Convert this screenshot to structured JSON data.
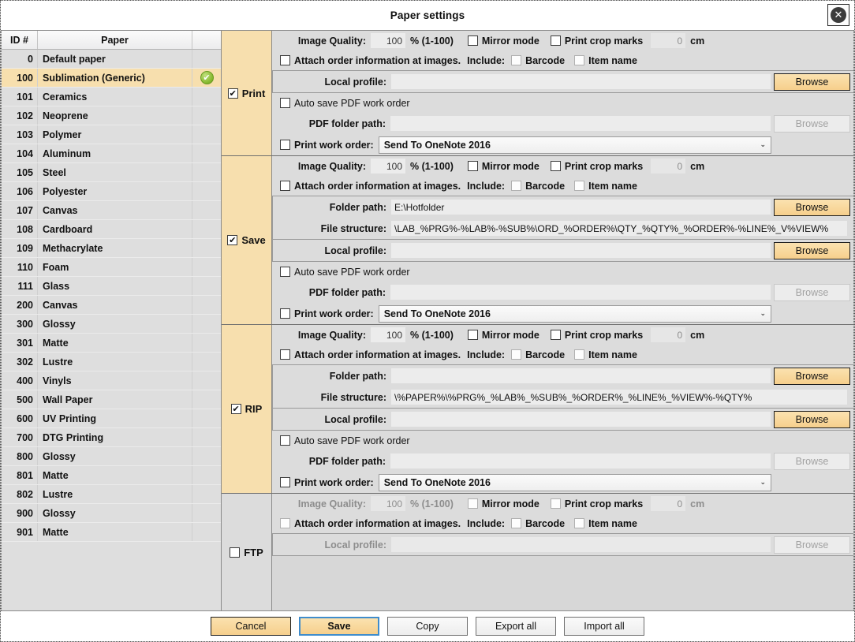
{
  "window": {
    "title": "Paper settings",
    "close_icon": "close-icon",
    "close_glyph": "✕"
  },
  "paper_list": {
    "columns": [
      "ID #",
      "Paper",
      ""
    ],
    "selected_id": "100",
    "selected_badge_glyph": "✔",
    "rows": [
      {
        "id": "0",
        "name": "Default paper"
      },
      {
        "id": "100",
        "name": "Sublimation (Generic)"
      },
      {
        "id": "101",
        "name": "Ceramics"
      },
      {
        "id": "102",
        "name": "Neoprene"
      },
      {
        "id": "103",
        "name": "Polymer"
      },
      {
        "id": "104",
        "name": "Aluminum"
      },
      {
        "id": "105",
        "name": "Steel"
      },
      {
        "id": "106",
        "name": "Polyester"
      },
      {
        "id": "107",
        "name": "Canvas"
      },
      {
        "id": "108",
        "name": "Cardboard"
      },
      {
        "id": "109",
        "name": "Methacrylate"
      },
      {
        "id": "110",
        "name": "Foam"
      },
      {
        "id": "111",
        "name": "Glass"
      },
      {
        "id": "200",
        "name": "Canvas"
      },
      {
        "id": "300",
        "name": "Glossy"
      },
      {
        "id": "301",
        "name": "Matte"
      },
      {
        "id": "302",
        "name": "Lustre"
      },
      {
        "id": "400",
        "name": "Vinyls"
      },
      {
        "id": "500",
        "name": "Wall Paper"
      },
      {
        "id": "600",
        "name": "UV Printing"
      },
      {
        "id": "700",
        "name": "DTG Printing"
      },
      {
        "id": "800",
        "name": "Glossy"
      },
      {
        "id": "801",
        "name": "Matte"
      },
      {
        "id": "802",
        "name": "Lustre"
      },
      {
        "id": "900",
        "name": "Glossy"
      },
      {
        "id": "901",
        "name": "Matte"
      }
    ]
  },
  "labels": {
    "image_quality": "Image Quality:",
    "quality_unit": "% (1-100)",
    "mirror_mode": "Mirror mode",
    "print_crop_marks": "Print crop marks",
    "cm_unit": "cm",
    "attach_order": "Attach order information at images.",
    "include": "Include:",
    "barcode": "Barcode",
    "item_name": "Item name",
    "local_profile": "Local profile:",
    "auto_save_pdf": "Auto save PDF work order",
    "pdf_folder_path": "PDF folder path:",
    "print_work_order": "Print work order:",
    "folder_path": "Folder path:",
    "file_structure": "File structure:",
    "browse": "Browse"
  },
  "sections": [
    {
      "name": "Print",
      "enabled": true,
      "image_quality": "100",
      "crop_margin": "0",
      "mirror_mode": false,
      "print_crop_marks": false,
      "attach_order": false,
      "barcode": false,
      "item_name": false,
      "has_folder_rows": false,
      "folder_path": "",
      "file_structure": "",
      "local_profile": "",
      "auto_save_pdf": false,
      "pdf_folder_path": "",
      "print_work_order": false,
      "work_order_printer": "Send To OneNote 2016"
    },
    {
      "name": "Save",
      "enabled": true,
      "image_quality": "100",
      "crop_margin": "0",
      "mirror_mode": false,
      "print_crop_marks": false,
      "attach_order": false,
      "barcode": false,
      "item_name": false,
      "has_folder_rows": true,
      "folder_path": "E:\\Hotfolder",
      "file_structure": "\\LAB_%PRG%-%LAB%-%SUB%\\ORD_%ORDER%\\QTY_%QTY%_%ORDER%-%LINE%_V%VIEW%",
      "local_profile": "",
      "auto_save_pdf": false,
      "pdf_folder_path": "",
      "print_work_order": false,
      "work_order_printer": "Send To OneNote 2016"
    },
    {
      "name": "RIP",
      "enabled": true,
      "image_quality": "100",
      "crop_margin": "0",
      "mirror_mode": false,
      "print_crop_marks": false,
      "attach_order": false,
      "barcode": false,
      "item_name": false,
      "has_folder_rows": true,
      "folder_path": "",
      "file_structure": "\\%PAPER%\\%PRG%_%LAB%_%SUB%_%ORDER%_%LINE%_%VIEW%-%QTY%",
      "local_profile": "",
      "auto_save_pdf": false,
      "pdf_folder_path": "",
      "print_work_order": false,
      "work_order_printer": "Send To OneNote 2016"
    },
    {
      "name": "FTP",
      "enabled": false,
      "image_quality": "100",
      "crop_margin": "0",
      "mirror_mode": false,
      "print_crop_marks": false,
      "attach_order": false,
      "barcode": false,
      "item_name": false,
      "has_folder_rows": false,
      "folder_path": "",
      "file_structure": "",
      "local_profile": "",
      "auto_save_pdf": false,
      "pdf_folder_path": "",
      "print_work_order": false,
      "work_order_printer": ""
    }
  ],
  "footer": {
    "buttons": [
      {
        "label": "Cancel",
        "style": "accent"
      },
      {
        "label": "Save",
        "style": "focus"
      },
      {
        "label": "Copy",
        "style": "plain"
      },
      {
        "label": "Export all",
        "style": "plain"
      },
      {
        "label": "Import all",
        "style": "plain"
      }
    ]
  },
  "glyphs": {
    "checkmark": "✔",
    "chevron_down": "⌄"
  },
  "colors": {
    "accent": "#f6cf8c",
    "selected_row": "#f7dfae",
    "panel": "#dcdcdc",
    "focus_border": "#3f8ccc",
    "badge_green": "#82b72b"
  }
}
